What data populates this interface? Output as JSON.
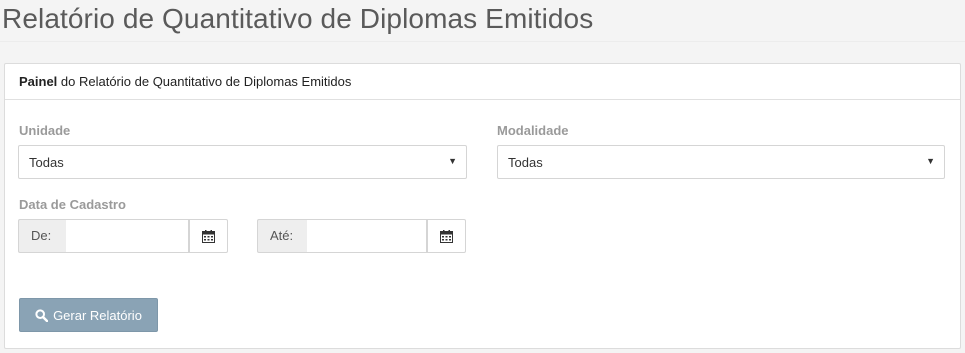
{
  "page": {
    "title": "Relatório de Quantitativo de Diplomas Emitidos"
  },
  "panel": {
    "heading_bold": "Painel",
    "heading_rest": " do Relatório de Quantitativo de Diplomas Emitidos"
  },
  "filters": {
    "unidade_label": "Unidade",
    "unidade_value": "Todas",
    "modalidade_label": "Modalidade",
    "modalidade_value": "Todas",
    "data_label": "Data de Cadastro",
    "de_label": "De:",
    "ate_label": "Até:",
    "de_value": "",
    "ate_value": ""
  },
  "actions": {
    "generate_label": "Gerar Relatório"
  },
  "icons": {
    "calendar": "calendar-icon",
    "search": "search-icon",
    "caret": "caret-down-icon"
  },
  "colors": {
    "button_bg": "#8aa3b5",
    "label": "#9a9a9a",
    "title": "#5a5a5a"
  }
}
